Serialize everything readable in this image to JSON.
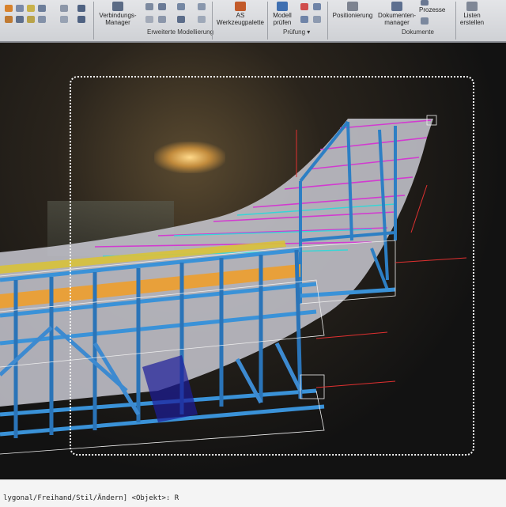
{
  "ribbon": {
    "buttons": {
      "verbindungs_manager": "Verbindungs-Manager",
      "as_werkzeugpalette": "AS Werkzeugpalette",
      "modell_pruefen": "Modell prüfen",
      "positionierung": "Positionierung",
      "dokumente_manager": "Dokumenten-manager",
      "prozesse": "Prozesse",
      "listen_erstellen": "Listen erstellen"
    },
    "groups": {
      "erweiterte_modellierung": "Erweiterte Modellierung",
      "pruefung": "Prüfung ▾",
      "dokumente": "Dokumente"
    }
  },
  "command_line": {
    "text": "lygonal/Freihand/Stil/Ändern] <Objekt>: R"
  },
  "colors": {
    "ribbon_bg": "#d9dadd",
    "canvas_bg": "#121212",
    "steel_blue": "#2d7fc4",
    "magenta_lines": "#d23ad0",
    "orange_deck": "#e8a03a",
    "selection_border": "#f2f2f2"
  }
}
